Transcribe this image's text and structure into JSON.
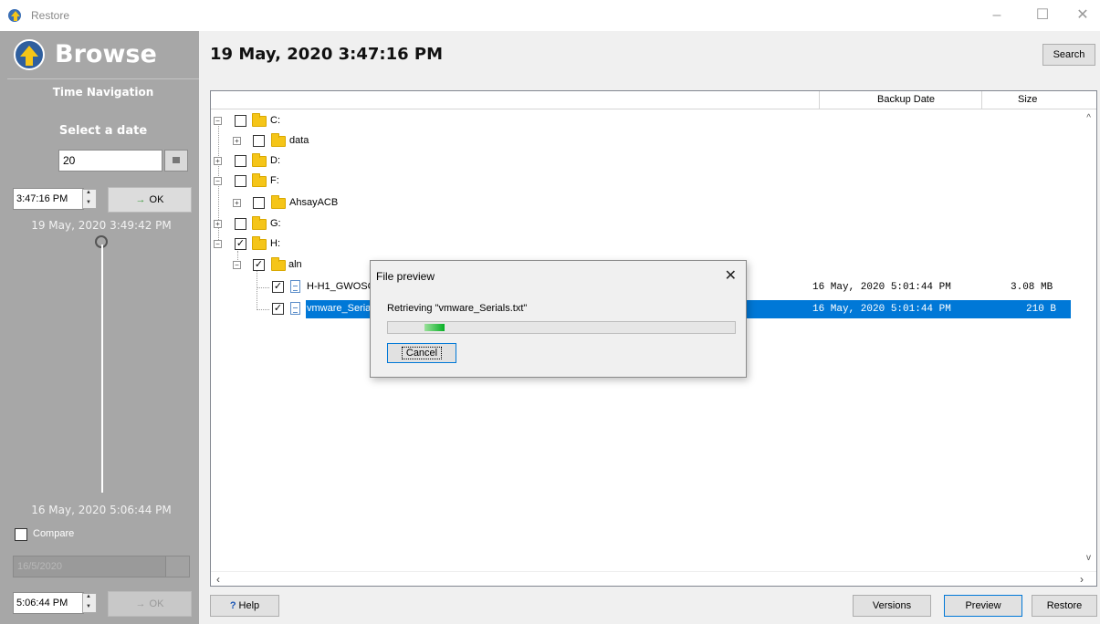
{
  "window": {
    "title": "Restore"
  },
  "sidebar": {
    "browse_label": "Browse",
    "time_navigation": "Time Navigation",
    "select_date": "Select a date",
    "date_value": "20",
    "time_value": "3:47:16 PM",
    "ok_label": "OK",
    "top_timestamp": "19 May, 2020 3:49:42 PM",
    "bottom_timestamp": "16 May, 2020 5:06:44 PM",
    "compare_label": "Compare",
    "compare_date": "16/5/2020",
    "compare_time": "5:06:44 PM",
    "compare_ok_label": "OK"
  },
  "header": {
    "datetime": "19 May, 2020 3:47:16 PM",
    "search_label": "Search"
  },
  "columns": {
    "backup_date": "Backup Date",
    "size": "Size"
  },
  "tree": {
    "c_drive": "C:",
    "data_folder": "data",
    "d_drive": "D:",
    "f_drive": "F:",
    "ahsay_folder": "AhsayACB",
    "g_drive": "G:",
    "h_drive": "H:",
    "aln_folder": "aln",
    "file1": {
      "name": "H-H1_GWOSC",
      "date": "16 May, 2020 5:01:44 PM",
      "size": "3.08 MB"
    },
    "file2": {
      "name": "vmware_Seria",
      "date": "16 May, 2020 5:01:44 PM",
      "size": "210 B"
    }
  },
  "dialog": {
    "title": "File preview",
    "message": "Retrieving \"vmware_Serials.txt\"",
    "cancel_label": "Cancel"
  },
  "footer": {
    "help_label": "Help",
    "versions_label": "Versions",
    "preview_label": "Preview",
    "restore_label": "Restore"
  },
  "colors": {
    "sidebar_bg": "#a7a7a7",
    "selection": "#0078d7",
    "progress": "#06b025"
  }
}
